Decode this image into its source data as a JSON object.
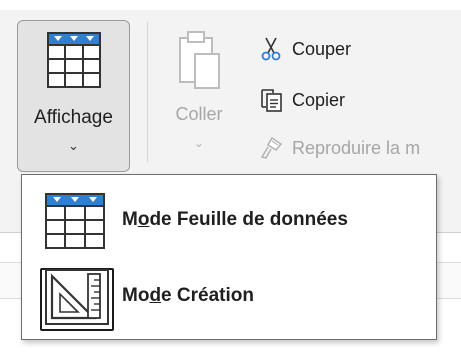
{
  "ribbon": {
    "affichage": {
      "label": "Affichage",
      "chevron": "⌄",
      "icon": "datasheet-grid-icon"
    },
    "coller": {
      "label": "Coller",
      "chevron": "⌄",
      "icon": "clipboard-paste-icon"
    },
    "couper": {
      "label": "Couper",
      "icon": "scissors-icon"
    },
    "copier": {
      "label": "Copier",
      "icon": "copy-icon"
    },
    "reproduire": {
      "label": "Reproduire la m",
      "icon": "format-painter-icon"
    }
  },
  "dropdown": {
    "items": [
      {
        "pre": "M",
        "key": "o",
        "post": "de Feuille de données",
        "icon": "datasheet-view-icon",
        "selected": false
      },
      {
        "pre": "Mo",
        "key": "d",
        "post": "e Création",
        "icon": "design-view-icon",
        "selected": true
      }
    ]
  },
  "colors": {
    "accent_blue": "#2f7fd3",
    "icon_dark": "#333333",
    "disabled_text": "#a6a6a6",
    "button_pressed_bg": "#e3e3e3"
  }
}
